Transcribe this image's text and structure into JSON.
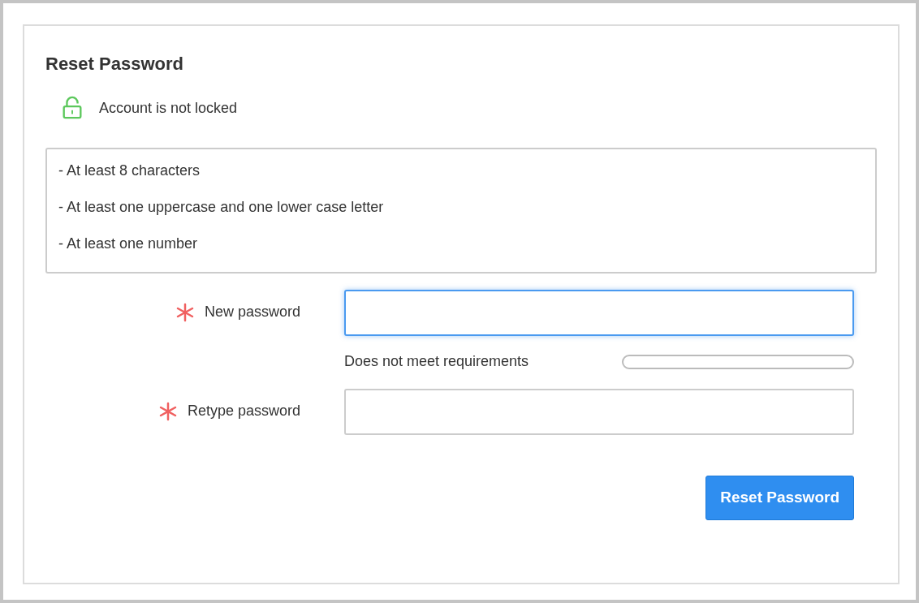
{
  "title": "Reset Password",
  "account": {
    "locked": false,
    "text": "Account is not locked"
  },
  "requirements": [
    "- At least 8 characters",
    "- At least one uppercase and one lower case letter",
    "- At least one number"
  ],
  "fields": [
    {
      "label": "New password",
      "required": true,
      "focused": true,
      "strength": {
        "text": "Does not meet requirements",
        "level": 0
      }
    },
    {
      "label": "Retype password",
      "required": true,
      "focused": false
    }
  ],
  "button": "Reset Password"
}
